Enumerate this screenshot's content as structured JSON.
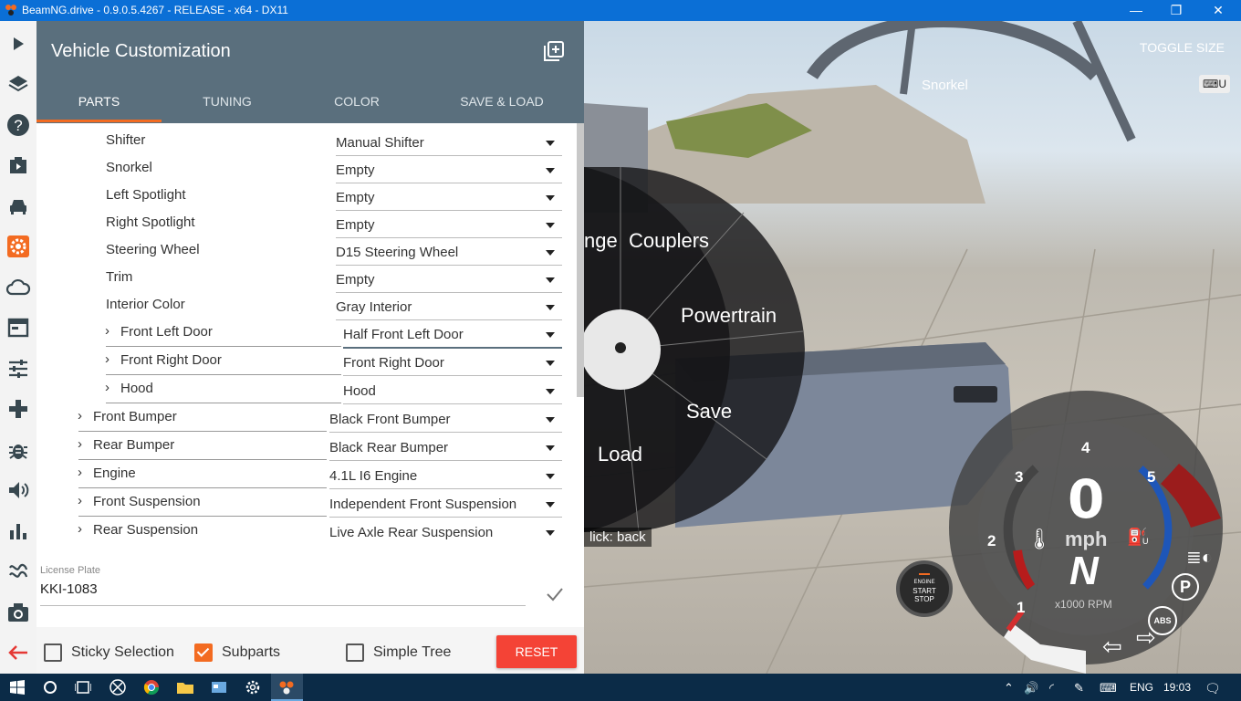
{
  "window": {
    "title": "BeamNG.drive - 0.9.0.5.4267 - RELEASE - x64 - DX11",
    "minimize": "—",
    "maximize": "❐",
    "close": "✕"
  },
  "rail": {
    "icons": [
      "play-icon",
      "layers-icon",
      "help-icon",
      "scenario-icon",
      "car-icon",
      "gear-icon",
      "cloud-icon",
      "dashboard-icon",
      "sliders-icon",
      "gamepad-icon",
      "bug-icon",
      "sound-icon",
      "chart-icon",
      "path-icon",
      "camera-icon",
      "back-arrow-icon"
    ],
    "active_color": "#f36b21"
  },
  "panel": {
    "title": "Vehicle Customization",
    "tabs": [
      {
        "label": "PARTS"
      },
      {
        "label": "TUNING"
      },
      {
        "label": "COLOR"
      },
      {
        "label": "SAVE & LOAD"
      }
    ],
    "parts": [
      {
        "label": "Shifter",
        "value": "Manual Shifter"
      },
      {
        "label": "Snorkel",
        "value": "Empty"
      },
      {
        "label": "Left Spotlight",
        "value": "Empty"
      },
      {
        "label": "Right Spotlight",
        "value": "Empty"
      },
      {
        "label": "Steering Wheel",
        "value": "D15 Steering Wheel"
      },
      {
        "label": "Trim",
        "value": "Empty"
      },
      {
        "label": "Interior Color",
        "value": "Gray Interior"
      },
      {
        "label": "Front Left Door",
        "value": "Half Front Left Door"
      },
      {
        "label": "Front Right Door",
        "value": "Front Right Door"
      },
      {
        "label": "Hood",
        "value": "Hood"
      },
      {
        "label": "Front Bumper",
        "value": "Black Front Bumper"
      },
      {
        "label": "Rear Bumper",
        "value": "Black Rear Bumper"
      },
      {
        "label": "Engine",
        "value": "4.1L I6 Engine"
      },
      {
        "label": "Front Suspension",
        "value": "Independent Front Suspension"
      },
      {
        "label": "Rear Suspension",
        "value": "Live Axle Rear Suspension"
      }
    ],
    "license_plate": {
      "label": "License Plate",
      "value": "KKI-1083"
    },
    "options": {
      "sticky_selection": {
        "label": "Sticky Selection",
        "checked": false
      },
      "subparts": {
        "label": "Subparts",
        "checked": true
      },
      "simple_tree": {
        "label": "Simple Tree",
        "checked": false
      }
    },
    "reset_label": "RESET",
    "accent": "#f36b21",
    "header_color": "#5a6f7d",
    "reset_color": "#f44336"
  },
  "game": {
    "toggle_size": "TOGGLE SIZE",
    "snorkel": "Snorkel",
    "kbd_hint": "U",
    "radial": {
      "items": [
        "nge",
        "Couplers",
        "Powertrain",
        "Save",
        "Load"
      ],
      "back_hint": "lick: back"
    },
    "engine_button": [
      "ENGINE",
      "START",
      "STOP"
    ],
    "gauge": {
      "ticks": [
        "1",
        "2",
        "3",
        "4",
        "5"
      ],
      "speed": "0",
      "unit": "mph",
      "gear": "N",
      "rpm_label": "x1000 RPM",
      "parking": "P",
      "abs": "ABS",
      "fuel_hint": "U"
    }
  },
  "taskbar": {
    "language": "ENG",
    "time": "19:03"
  }
}
